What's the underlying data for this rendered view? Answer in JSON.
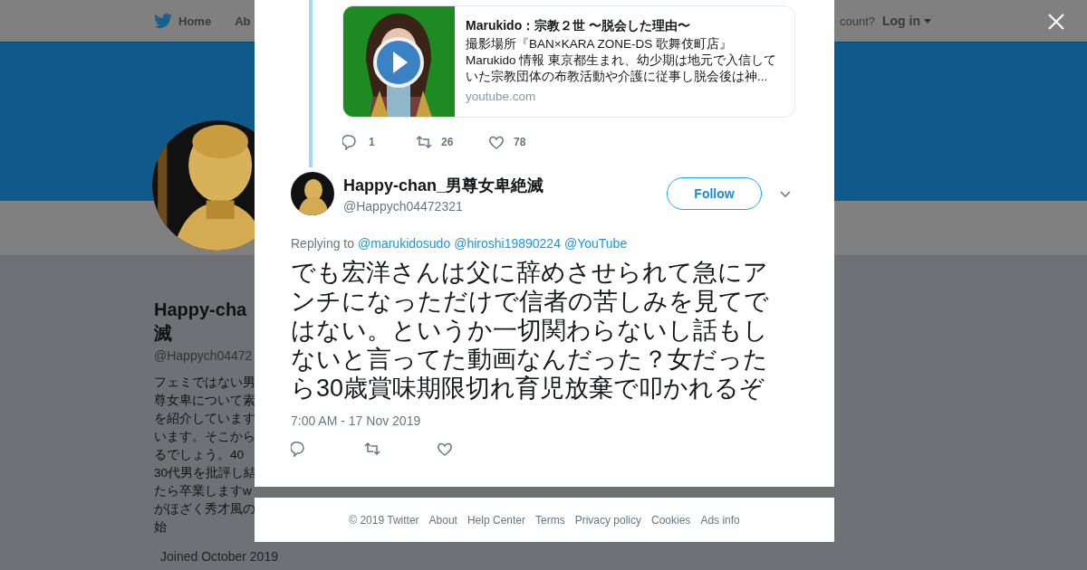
{
  "background_page": {
    "nav": {
      "items": [
        {
          "label": "Home",
          "kind": "home"
        },
        {
          "label": "Ab",
          "kind": "text"
        }
      ],
      "account_prompt": "count?",
      "login": "Log in"
    },
    "profile": {
      "name_lines": [
        "Happy-cha",
        "滅"
      ],
      "handle": "@Happych04472",
      "bio_lines": [
        "フェミではない男",
        "尊女卑について素",
        "を紹介しています",
        "います。そこから",
        "るでしょう。40",
        "30代男を批評し結",
        "たら卒業しますw",
        "がほざく秀才風の",
        "始"
      ],
      "joined": "Joined October 2019"
    }
  },
  "modal": {
    "quoted_card": {
      "kind": "video",
      "title": "Marukido：宗教２世 〜脱会した理由〜",
      "description": "撮影場所『BAN×KARA ZONE-DS 歌舞伎町店』\nMarukido 情報 東京都生まれ、幼少期は地元で入信していた宗教団体の布教活動や介護に従事し脱会後は神...",
      "domain": "youtube.com"
    },
    "parent_actions": [
      {
        "kind": "reply",
        "count": "1"
      },
      {
        "kind": "retweet",
        "count": "26"
      },
      {
        "kind": "like",
        "count": "78"
      }
    ],
    "tweet": {
      "name": "Happy-chan_男尊女卑絶滅",
      "handle": "@Happych04472321",
      "follow_label": "Follow",
      "replying_label": "Replying to",
      "mentions": [
        "@marukidosudo",
        "@hiroshi19890224",
        "@YouTube"
      ],
      "text": "でも宏洋さんは父に辞めさせられて急にアンチになっただけで信者の苦しみを見てではない。というか一切関わらないし話もしないと言ってた動画なんだった？女だったら30歳賞味期限切れ育児放棄で叩かれるぞ",
      "timestamp": "7:00 AM - 17 Nov 2019",
      "actions": [
        {
          "kind": "reply"
        },
        {
          "kind": "retweet"
        },
        {
          "kind": "like"
        }
      ]
    }
  },
  "footer": {
    "links": [
      "© 2019 Twitter",
      "About",
      "Help Center",
      "Terms",
      "Privacy policy",
      "Cookies",
      "Ads info"
    ]
  }
}
